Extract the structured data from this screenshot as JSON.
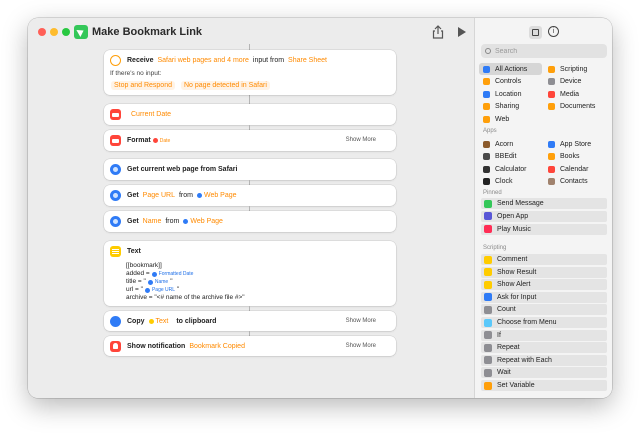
{
  "window": {
    "title": "Make Bookmark Link"
  },
  "actions": {
    "receive": {
      "label": "Receive",
      "input_types": "Safari web pages and 4 more",
      "input_from_label": "input from",
      "source": "Share Sheet",
      "if_no_input_label": "If there's no input:",
      "no_input_action": "Stop and Respond",
      "no_input_message": "No page detected in Safari"
    },
    "current_date": {
      "token": "Current Date"
    },
    "format": {
      "label": "Format",
      "token": "Date",
      "show_more": "Show More"
    },
    "get_current_page": {
      "label": "Get current web page from Safari"
    },
    "get_url": {
      "label": "Get",
      "token": "Page URL",
      "from_label": "from",
      "variable": "Web Page"
    },
    "get_name": {
      "label": "Get",
      "token": "Name",
      "from_label": "from",
      "variable": "Web Page"
    },
    "text": {
      "label": "Text",
      "line1": "[[bookmark]]",
      "line2_prefix": "added = ",
      "line2_var": "Formatted Date",
      "line3_prefix": "title = \"",
      "line3_var": "Name",
      "line3_suffix": "\"",
      "line4_prefix": "url = \"",
      "line4_var": "Page URL",
      "line4_suffix": "\"",
      "line5": "archive = \"<# name of the archive file #>\""
    },
    "copy": {
      "label": "Copy",
      "token": "Text",
      "suffix": "to clipboard",
      "show_more": "Show More"
    },
    "notification": {
      "label": "Show notification",
      "token": "Bookmark Copied",
      "show_more": "Show More"
    }
  },
  "sidebar": {
    "search_placeholder": "Search",
    "categories": [
      {
        "label": "All Actions",
        "color": "#2f7bf6",
        "icon": "grid-icon"
      },
      {
        "label": "Scripting",
        "color": "#ff9f0a",
        "icon": "scripting-icon"
      },
      {
        "label": "Controls",
        "color": "#ff9f0a",
        "icon": "controls-icon"
      },
      {
        "label": "Device",
        "color": "#8e8e93",
        "icon": "device-icon"
      },
      {
        "label": "Location",
        "color": "#2f7bf6",
        "icon": "location-icon"
      },
      {
        "label": "Media",
        "color": "#ff453a",
        "icon": "media-icon"
      },
      {
        "label": "Sharing",
        "color": "#ff9f0a",
        "icon": "sharing-icon"
      },
      {
        "label": "Documents",
        "color": "#ff9f0a",
        "icon": "documents-icon"
      },
      {
        "label": "Web",
        "color": "#ff9f0a",
        "icon": "web-icon"
      }
    ],
    "apps_label": "Apps",
    "apps": [
      {
        "label": "Acorn",
        "color": "#8b5a2b"
      },
      {
        "label": "App Store",
        "color": "#2f7bf6"
      },
      {
        "label": "BBEdit",
        "color": "#4a4a4a"
      },
      {
        "label": "Books",
        "color": "#ff9f0a"
      },
      {
        "label": "Calculator",
        "color": "#333333"
      },
      {
        "label": "Calendar",
        "color": "#ff453a"
      },
      {
        "label": "Clock",
        "color": "#222222"
      },
      {
        "label": "Contacts",
        "color": "#a0826d"
      }
    ],
    "pinned_label": "Pinned",
    "pinned": [
      {
        "label": "Send Message",
        "color": "#34c759"
      },
      {
        "label": "Open App",
        "color": "#5856d6"
      },
      {
        "label": "Play Music",
        "color": "#ff2d55"
      }
    ],
    "scripting_label": "Scripting",
    "scripting": [
      {
        "label": "Comment",
        "color": "#ffcc00"
      },
      {
        "label": "Show Result",
        "color": "#ffcc00"
      },
      {
        "label": "Show Alert",
        "color": "#ffcc00"
      },
      {
        "label": "Ask for Input",
        "color": "#2f7bf6"
      },
      {
        "label": "Count",
        "color": "#8e8e93"
      },
      {
        "label": "Choose from Menu",
        "color": "#5ac8fa"
      },
      {
        "label": "If",
        "color": "#8e8e93"
      },
      {
        "label": "Repeat",
        "color": "#8e8e93"
      },
      {
        "label": "Repeat with Each",
        "color": "#8e8e93"
      },
      {
        "label": "Wait",
        "color": "#8e8e93"
      },
      {
        "label": "Set Variable",
        "color": "#ff9f0a"
      }
    ]
  }
}
